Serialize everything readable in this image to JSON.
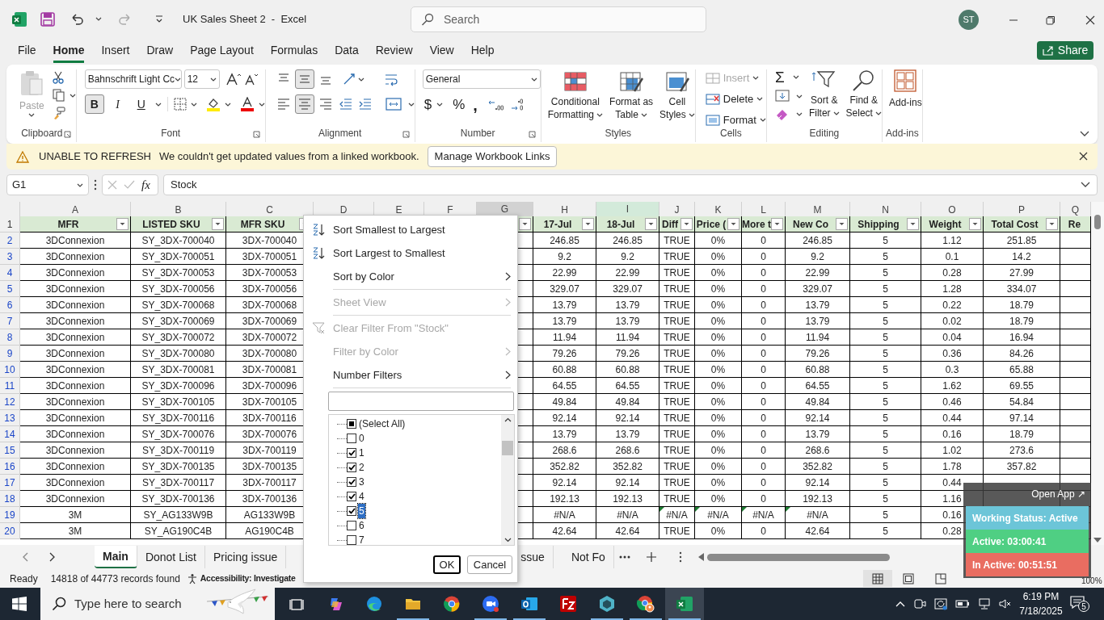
{
  "window": {
    "title": "UK Sales Sheet 2  -  Excel",
    "search_placeholder": "Search",
    "avatar": "ST"
  },
  "menu_tabs": [
    {
      "label": "File",
      "selected": false
    },
    {
      "label": "Home",
      "selected": true
    },
    {
      "label": "Insert",
      "selected": false
    },
    {
      "label": "Draw",
      "selected": false
    },
    {
      "label": "Page Layout",
      "selected": false
    },
    {
      "label": "Formulas",
      "selected": false
    },
    {
      "label": "Data",
      "selected": false
    },
    {
      "label": "Review",
      "selected": false
    },
    {
      "label": "View",
      "selected": false
    },
    {
      "label": "Help",
      "selected": false
    }
  ],
  "share_button": "Share",
  "ribbon": {
    "clipboard": {
      "label": "Clipboard",
      "paste": "Paste"
    },
    "font": {
      "label": "Font",
      "name": "Bahnschrift Light Cc",
      "size": "12",
      "styles": [
        {
          "label": "B",
          "kind": "bold",
          "selected": true
        },
        {
          "label": "I",
          "kind": "italic",
          "selected": false
        },
        {
          "label": "U",
          "kind": "underline",
          "selected": false
        }
      ]
    },
    "alignment": {
      "label": "Alignment",
      "vertical": [
        {
          "kind": "top",
          "selected": false
        },
        {
          "kind": "middle",
          "selected": true
        },
        {
          "kind": "bottom",
          "selected": false
        }
      ],
      "horizontal": [
        {
          "kind": "left",
          "selected": false
        },
        {
          "kind": "center",
          "selected": true
        },
        {
          "kind": "right",
          "selected": false
        }
      ]
    },
    "number": {
      "label": "Number",
      "format": "General",
      "currency": "$",
      "percent": "%",
      "comma": ","
    },
    "styles": {
      "label": "Styles",
      "buttons": [
        {
          "kind": "conditional",
          "lines": [
            "Conditional",
            "Formatting"
          ]
        },
        {
          "kind": "table",
          "lines": [
            "Format as",
            "Table"
          ]
        },
        {
          "kind": "cell",
          "lines": [
            "Cell",
            "Styles"
          ]
        }
      ]
    },
    "cells": {
      "label": "Cells",
      "buttons": [
        {
          "kind": "insert",
          "label": "Insert",
          "disabled": true
        },
        {
          "kind": "delete",
          "label": "Delete",
          "disabled": false
        },
        {
          "kind": "format",
          "label": "Format",
          "disabled": false
        }
      ]
    },
    "editing": {
      "label": "Editing",
      "sum": "Σ",
      "buttons": [
        {
          "kind": "sort",
          "lines": [
            "Sort &",
            "Filter"
          ]
        },
        {
          "kind": "find",
          "lines": [
            "Find &",
            "Select"
          ]
        }
      ]
    },
    "addins": {
      "label": "Add-ins",
      "button": "Add-ins"
    }
  },
  "message_bar": {
    "title": "UNABLE TO REFRESH",
    "text": "We couldn't get updated values from a linked workbook.",
    "button": "Manage Workbook Links"
  },
  "formula_bar": {
    "name_box": "G1",
    "fx": "fx",
    "formula": "Stock"
  },
  "sheet": {
    "header_row": "1",
    "columns": [
      {
        "letter": "A",
        "header": "MFR",
        "selected": false,
        "highlighted": false,
        "filter": true
      },
      {
        "letter": "B",
        "header": "LISTED SKU",
        "selected": false,
        "highlighted": false,
        "filter": true
      },
      {
        "letter": "C",
        "header": "MFR SKU",
        "selected": false,
        "highlighted": false,
        "filter": true
      },
      {
        "letter": "D",
        "selected": false,
        "highlighted": false,
        "filter": false
      },
      {
        "letter": "E",
        "selected": false,
        "highlighted": false,
        "filter": false
      },
      {
        "letter": "F",
        "selected": false,
        "highlighted": false,
        "filter": false
      },
      {
        "letter": "G",
        "selected": true,
        "highlighted": false,
        "filter": true
      },
      {
        "letter": "H",
        "header": "17-Jul",
        "selected": false,
        "highlighted": false,
        "filter": true
      },
      {
        "letter": "I",
        "header": "18-Jul",
        "selected": false,
        "highlighted": true,
        "filter": true
      },
      {
        "letter": "J",
        "header": "Diff",
        "selected": false,
        "highlighted": false,
        "filter": true
      },
      {
        "letter": "K",
        "header": "Price (",
        "selected": false,
        "highlighted": false,
        "filter": true
      },
      {
        "letter": "L",
        "header": "More t",
        "selected": false,
        "highlighted": false,
        "filter": true
      },
      {
        "letter": "M",
        "header": "New Co",
        "selected": false,
        "highlighted": false,
        "filter": true
      },
      {
        "letter": "N",
        "header": "Shipping",
        "selected": false,
        "highlighted": false,
        "filter": true
      },
      {
        "letter": "O",
        "header": "Weight",
        "selected": false,
        "highlighted": false,
        "filter": true
      },
      {
        "letter": "P",
        "header": "Total Cost",
        "selected": false,
        "highlighted": false,
        "filter": true
      },
      {
        "letter": "Q",
        "header": "Re",
        "selected": false,
        "highlighted": false,
        "filter": false
      }
    ],
    "rows": [
      {
        "n": "2",
        "error_marks": false,
        "cells": [
          "3DConnexion",
          "SY_3DX-700040",
          "3DX-700040",
          null,
          null,
          null,
          null,
          "246.85",
          "246.85",
          "TRUE",
          "0%",
          "0",
          "246.85",
          "5",
          "1.12",
          "251.85",
          null
        ]
      },
      {
        "n": "3",
        "error_marks": false,
        "cells": [
          "3DConnexion",
          "SY_3DX-700051",
          "3DX-700051",
          null,
          null,
          null,
          null,
          "9.2",
          "9.2",
          "TRUE",
          "0%",
          "0",
          "9.2",
          "5",
          "0.1",
          "14.2",
          null
        ]
      },
      {
        "n": "4",
        "error_marks": false,
        "cells": [
          "3DConnexion",
          "SY_3DX-700053",
          "3DX-700053",
          null,
          null,
          null,
          null,
          "22.99",
          "22.99",
          "TRUE",
          "0%",
          "0",
          "22.99",
          "5",
          "0.28",
          "27.99",
          null
        ]
      },
      {
        "n": "5",
        "error_marks": false,
        "cells": [
          "3DConnexion",
          "SY_3DX-700056",
          "3DX-700056",
          null,
          null,
          null,
          null,
          "329.07",
          "329.07",
          "TRUE",
          "0%",
          "0",
          "329.07",
          "5",
          "1.28",
          "334.07",
          null
        ]
      },
      {
        "n": "6",
        "error_marks": false,
        "cells": [
          "3DConnexion",
          "SY_3DX-700068",
          "3DX-700068",
          null,
          null,
          null,
          null,
          "13.79",
          "13.79",
          "TRUE",
          "0%",
          "0",
          "13.79",
          "5",
          "0.22",
          "18.79",
          null
        ]
      },
      {
        "n": "7",
        "error_marks": false,
        "cells": [
          "3DConnexion",
          "SY_3DX-700069",
          "3DX-700069",
          null,
          null,
          null,
          null,
          "13.79",
          "13.79",
          "TRUE",
          "0%",
          "0",
          "13.79",
          "5",
          "0.02",
          "18.79",
          null
        ]
      },
      {
        "n": "8",
        "error_marks": false,
        "cells": [
          "3DConnexion",
          "SY_3DX-700072",
          "3DX-700072",
          null,
          null,
          null,
          null,
          "11.94",
          "11.94",
          "TRUE",
          "0%",
          "0",
          "11.94",
          "5",
          "0.04",
          "16.94",
          null
        ]
      },
      {
        "n": "9",
        "error_marks": false,
        "cells": [
          "3DConnexion",
          "SY_3DX-700080",
          "3DX-700080",
          null,
          null,
          null,
          null,
          "79.26",
          "79.26",
          "TRUE",
          "0%",
          "0",
          "79.26",
          "5",
          "0.36",
          "84.26",
          null
        ]
      },
      {
        "n": "10",
        "error_marks": false,
        "cells": [
          "3DConnexion",
          "SY_3DX-700081",
          "3DX-700081",
          null,
          null,
          null,
          null,
          "60.88",
          "60.88",
          "TRUE",
          "0%",
          "0",
          "60.88",
          "5",
          "0.3",
          "65.88",
          null
        ]
      },
      {
        "n": "11",
        "error_marks": false,
        "cells": [
          "3DConnexion",
          "SY_3DX-700096",
          "3DX-700096",
          null,
          null,
          null,
          null,
          "64.55",
          "64.55",
          "TRUE",
          "0%",
          "0",
          "64.55",
          "5",
          "1.62",
          "69.55",
          null
        ]
      },
      {
        "n": "12",
        "error_marks": false,
        "cells": [
          "3DConnexion",
          "SY_3DX-700105",
          "3DX-700105",
          null,
          null,
          null,
          null,
          "49.84",
          "49.84",
          "TRUE",
          "0%",
          "0",
          "49.84",
          "5",
          "0.46",
          "54.84",
          null
        ]
      },
      {
        "n": "13",
        "error_marks": false,
        "cells": [
          "3DConnexion",
          "SY_3DX-700116",
          "3DX-700116",
          null,
          null,
          null,
          null,
          "92.14",
          "92.14",
          "TRUE",
          "0%",
          "0",
          "92.14",
          "5",
          "0.44",
          "97.14",
          null
        ]
      },
      {
        "n": "14",
        "error_marks": false,
        "cells": [
          "3DConnexion",
          "SY_3DX-700076",
          "3DX-700076",
          null,
          null,
          null,
          null,
          "13.79",
          "13.79",
          "TRUE",
          "0%",
          "0",
          "13.79",
          "5",
          "0.16",
          "18.79",
          null
        ]
      },
      {
        "n": "15",
        "error_marks": false,
        "cells": [
          "3DConnexion",
          "SY_3DX-700119",
          "3DX-700119",
          null,
          null,
          null,
          null,
          "268.6",
          "268.6",
          "TRUE",
          "0%",
          "0",
          "268.6",
          "5",
          "1.02",
          "273.6",
          null
        ]
      },
      {
        "n": "16",
        "error_marks": false,
        "cells": [
          "3DConnexion",
          "SY_3DX-700135",
          "3DX-700135",
          null,
          null,
          null,
          null,
          "352.82",
          "352.82",
          "TRUE",
          "0%",
          "0",
          "352.82",
          "5",
          "1.78",
          "357.82",
          null
        ]
      },
      {
        "n": "17",
        "error_marks": false,
        "cells": [
          "3DConnexion",
          "SY_3DX-700117",
          "3DX-700117",
          null,
          null,
          null,
          null,
          "92.14",
          "92.14",
          "TRUE",
          "0%",
          "0",
          "92.14",
          "5",
          "0.44",
          null,
          null
        ]
      },
      {
        "n": "18",
        "error_marks": false,
        "cells": [
          "3DConnexion",
          "SY_3DX-700136",
          "3DX-700136",
          null,
          null,
          null,
          null,
          "192.13",
          "192.13",
          "TRUE",
          "0%",
          "0",
          "192.13",
          "5",
          "1.16",
          null,
          null
        ]
      },
      {
        "n": "19",
        "error_marks": true,
        "cells": [
          "3M",
          "SY_AG133W9B",
          "AG133W9B",
          null,
          null,
          null,
          null,
          "#N/A",
          "#N/A",
          "#N/A",
          "#N/A",
          "#N/A",
          "#N/A",
          "5",
          "0.16",
          null,
          null
        ]
      },
      {
        "n": "20",
        "error_marks": false,
        "cells": [
          "3M",
          "SY_AG190C4B",
          "AG190C4B",
          null,
          null,
          null,
          null,
          "42.64",
          "42.64",
          "TRUE",
          "0%",
          "0",
          "42.64",
          "5",
          "0.28",
          null,
          null
        ]
      }
    ]
  },
  "filter_menu": {
    "items": [
      {
        "label": "Sort Smallest to Largest",
        "kind": "sort_ascending",
        "disabled": false,
        "submenu": false,
        "divider_after": false
      },
      {
        "label": "Sort Largest to Smallest",
        "kind": "sort_descending",
        "disabled": false,
        "submenu": false,
        "divider_after": false
      },
      {
        "label": "Sort by Color",
        "kind": "plain",
        "disabled": false,
        "submenu": true,
        "divider_after": true
      },
      {
        "label": "Sheet View",
        "kind": "plain",
        "disabled": true,
        "submenu": true,
        "divider_after": true
      },
      {
        "label": "Clear Filter From \"Stock\"",
        "kind": "clear_filter",
        "disabled": true,
        "submenu": false,
        "divider_after": false
      },
      {
        "label": "Filter by Color",
        "kind": "plain",
        "disabled": true,
        "submenu": true,
        "divider_after": false
      },
      {
        "label": "Number Filters",
        "kind": "plain",
        "disabled": false,
        "submenu": true,
        "divider_after": true
      }
    ],
    "values": [
      {
        "label": "(Select All)",
        "checked": false,
        "partial": true,
        "selected": false
      },
      {
        "label": "0",
        "checked": false,
        "partial": false,
        "selected": false
      },
      {
        "label": "1",
        "checked": true,
        "partial": false,
        "selected": false
      },
      {
        "label": "2",
        "checked": true,
        "partial": false,
        "selected": false
      },
      {
        "label": "3",
        "checked": true,
        "partial": false,
        "selected": false
      },
      {
        "label": "4",
        "checked": true,
        "partial": false,
        "selected": false
      },
      {
        "label": "5",
        "checked": true,
        "partial": false,
        "selected": true
      },
      {
        "label": "6",
        "checked": false,
        "partial": false,
        "selected": false
      },
      {
        "label": "7",
        "checked": false,
        "partial": false,
        "selected": false
      }
    ],
    "buttons": [
      {
        "label": "OK",
        "default": true
      },
      {
        "label": "Cancel",
        "default": false
      }
    ]
  },
  "sheet_tabs": [
    {
      "label": "Main",
      "selected": true
    },
    {
      "label": "Donot List",
      "selected": false
    },
    {
      "label": "Pricing issue",
      "selected": false
    },
    {
      "label": "ssue",
      "selected": false
    },
    {
      "label": "Not Fo",
      "selected": false
    }
  ],
  "status_bar": {
    "ready": "Ready",
    "records": "14818 of 44773 records found",
    "accessibility": "Accessibility: Investigate",
    "zoom": "100%"
  },
  "timer_widget": {
    "open_app": "Open App ↗",
    "rows": [
      {
        "text": "Working Status: Active",
        "color": "#6cc5d8"
      },
      {
        "text": "Active: 03:00:41",
        "color": "#4fcf83"
      },
      {
        "text": "In Active: 00:51:51",
        "color": "#e96d61"
      }
    ]
  },
  "taskbar": {
    "search_placeholder": "Type here to search",
    "time": "6:19 PM",
    "date": "7/18/2025",
    "notifications": "5",
    "apps": [
      {
        "kind": "task_view",
        "running": false,
        "active": false
      },
      {
        "kind": "copilot",
        "running": false,
        "active": false
      },
      {
        "kind": "edge",
        "running": false,
        "active": false
      },
      {
        "kind": "folder",
        "running": true,
        "active": false
      },
      {
        "kind": "chrome",
        "running": false,
        "active": false
      },
      {
        "kind": "zoom",
        "running": true,
        "active": false
      },
      {
        "kind": "outlook",
        "running": true,
        "active": false
      },
      {
        "kind": "filezilla",
        "running": false,
        "active": false
      },
      {
        "kind": "cube",
        "running": true,
        "active": false
      },
      {
        "kind": "chrome_profile",
        "running": true,
        "active": false
      },
      {
        "kind": "excel",
        "running": true,
        "active": true
      }
    ]
  }
}
